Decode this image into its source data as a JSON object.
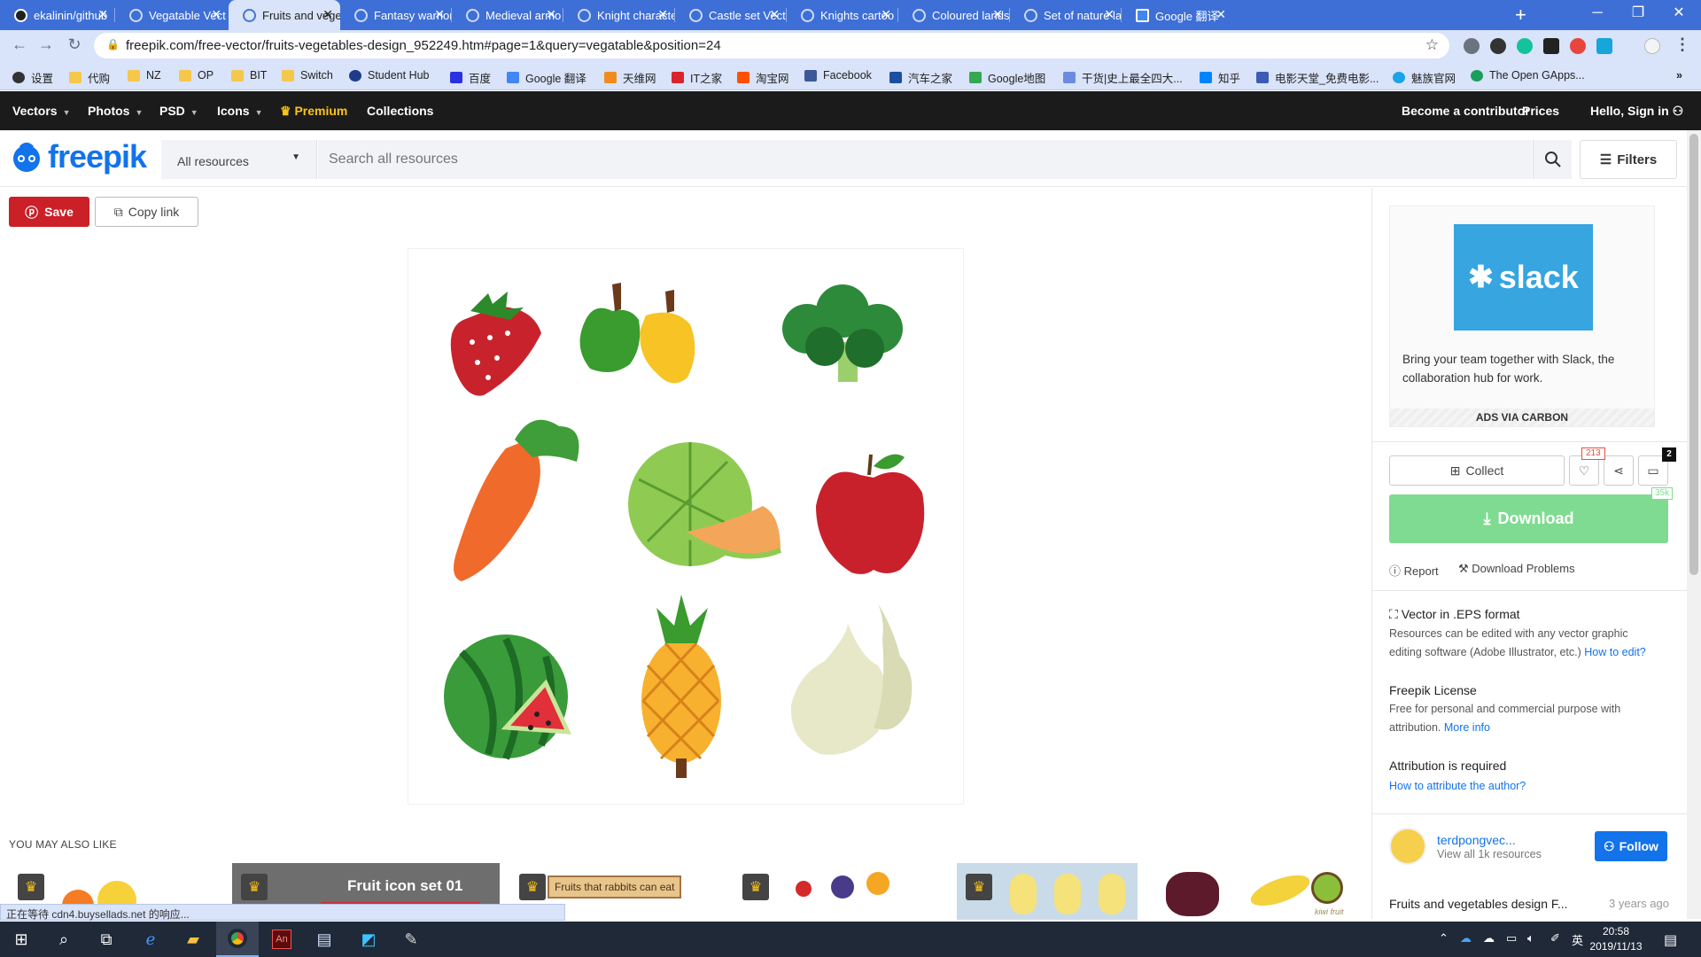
{
  "browser": {
    "tabs": [
      {
        "label": "ekalinin/github",
        "active": false
      },
      {
        "label": "Vegatable Vect",
        "active": false
      },
      {
        "label": "Fruits and vege",
        "active": true
      },
      {
        "label": "Fantasy warrior",
        "active": false
      },
      {
        "label": "Medieval armo",
        "active": false
      },
      {
        "label": "Knight characte",
        "active": false
      },
      {
        "label": "Castle set Vecto",
        "active": false
      },
      {
        "label": "Knights cartoo",
        "active": false
      },
      {
        "label": "Coloured lands",
        "active": false
      },
      {
        "label": "Set of nature la",
        "active": false
      },
      {
        "label": "Google 翻译",
        "active": false
      }
    ],
    "new_tab": "+",
    "url": "freepik.com/free-vector/fruits-vegetables-design_952249.htm#page=1&query=vegatable&position=24",
    "bookmarks": [
      {
        "label": "设置",
        "color": "#333"
      },
      {
        "label": "代购",
        "color": "#f5c84c"
      },
      {
        "label": "NZ",
        "color": "#f5c84c"
      },
      {
        "label": "OP",
        "color": "#f5c84c"
      },
      {
        "label": "BIT",
        "color": "#f5c84c"
      },
      {
        "label": "Switch",
        "color": "#f5c84c"
      },
      {
        "label": "Student Hub",
        "color": "#1e3a8a"
      },
      {
        "label": "百度",
        "color": "#2932e1"
      },
      {
        "label": "Google 翻译",
        "color": "#4285f4"
      },
      {
        "label": "天维网",
        "color": "#f08c1e"
      },
      {
        "label": "IT之家",
        "color": "#d9232d"
      },
      {
        "label": "淘宝网",
        "color": "#ff5000"
      },
      {
        "label": "Facebook",
        "color": "#3b5998"
      },
      {
        "label": "汽车之家",
        "color": "#1b4fa0"
      },
      {
        "label": "Google地图",
        "color": "#34a853"
      },
      {
        "label": "干货|史上最全四大...",
        "color": "#6b8be0"
      },
      {
        "label": "知乎",
        "color": "#0084ff"
      },
      {
        "label": "电影天堂_免费电影...",
        "color": "#3b5bb5"
      },
      {
        "label": "魅族官网",
        "color": "#1aa3e8"
      },
      {
        "label": "The Open GApps...",
        "color": "#1a9e5b"
      }
    ],
    "status_text": "正在等待 cdn4.buysellads.net 的响应..."
  },
  "site_nav": {
    "items": [
      {
        "label": "Vectors",
        "has_menu": true
      },
      {
        "label": "Photos",
        "has_menu": true
      },
      {
        "label": "PSD",
        "has_menu": true
      },
      {
        "label": "Icons",
        "has_menu": true
      },
      {
        "label": "Premium",
        "has_menu": false
      },
      {
        "label": "Collections",
        "has_menu": false
      }
    ],
    "right": {
      "contributor": "Become a contributor",
      "prices": "Prices",
      "signin": "Hello, Sign in"
    },
    "premium_color": "#fcc419"
  },
  "search": {
    "logo_text": "freepik",
    "resource_type": "All resources",
    "placeholder": "Search all resources",
    "filters_label": "Filters"
  },
  "actions": {
    "save_label": "Save",
    "copy_label": "Copy link"
  },
  "ad": {
    "brand": "slack",
    "text": "Bring your team together with Slack, the collaboration hub for work.",
    "carbon": "ADS VIA CARBON"
  },
  "resource": {
    "collect_label": "Collect",
    "likes": "213",
    "comments": "2",
    "download_label": "Download",
    "downloads": "35k",
    "report_label": "Report",
    "problems_label": "Download Problems",
    "format_title": "Vector in .EPS format",
    "format_body": "Resources can be edited with any vector graphic editing software (Adobe Illustrator, etc.)",
    "format_link": "How to edit?",
    "license_title": "Freepik License",
    "license_body": "Free for personal and commercial purpose with attribution.",
    "license_link": "More info",
    "attribution_title": "Attribution is required",
    "attribution_link": "How to attribute the author?"
  },
  "author": {
    "name": "terdpongvec...",
    "sub": "View all 1k resources",
    "follow_label": "Follow"
  },
  "bottom_item": {
    "title": "Fruits and vegetables design F...",
    "date": "3 years ago"
  },
  "also_like": {
    "label": "YOU MAY ALSO LIKE",
    "items": [
      {
        "caption": "",
        "premium": true
      },
      {
        "caption": "Fruit icon set 01",
        "premium": true
      },
      {
        "caption": "Fruits that rabbits can eat",
        "premium": true
      },
      {
        "caption": "",
        "premium": true
      },
      {
        "caption": "",
        "premium": true
      },
      {
        "caption": "kiwi fruit",
        "premium": false
      }
    ]
  },
  "taskbar": {
    "time": "20:58",
    "date": "2019/11/13",
    "ime": "英"
  }
}
